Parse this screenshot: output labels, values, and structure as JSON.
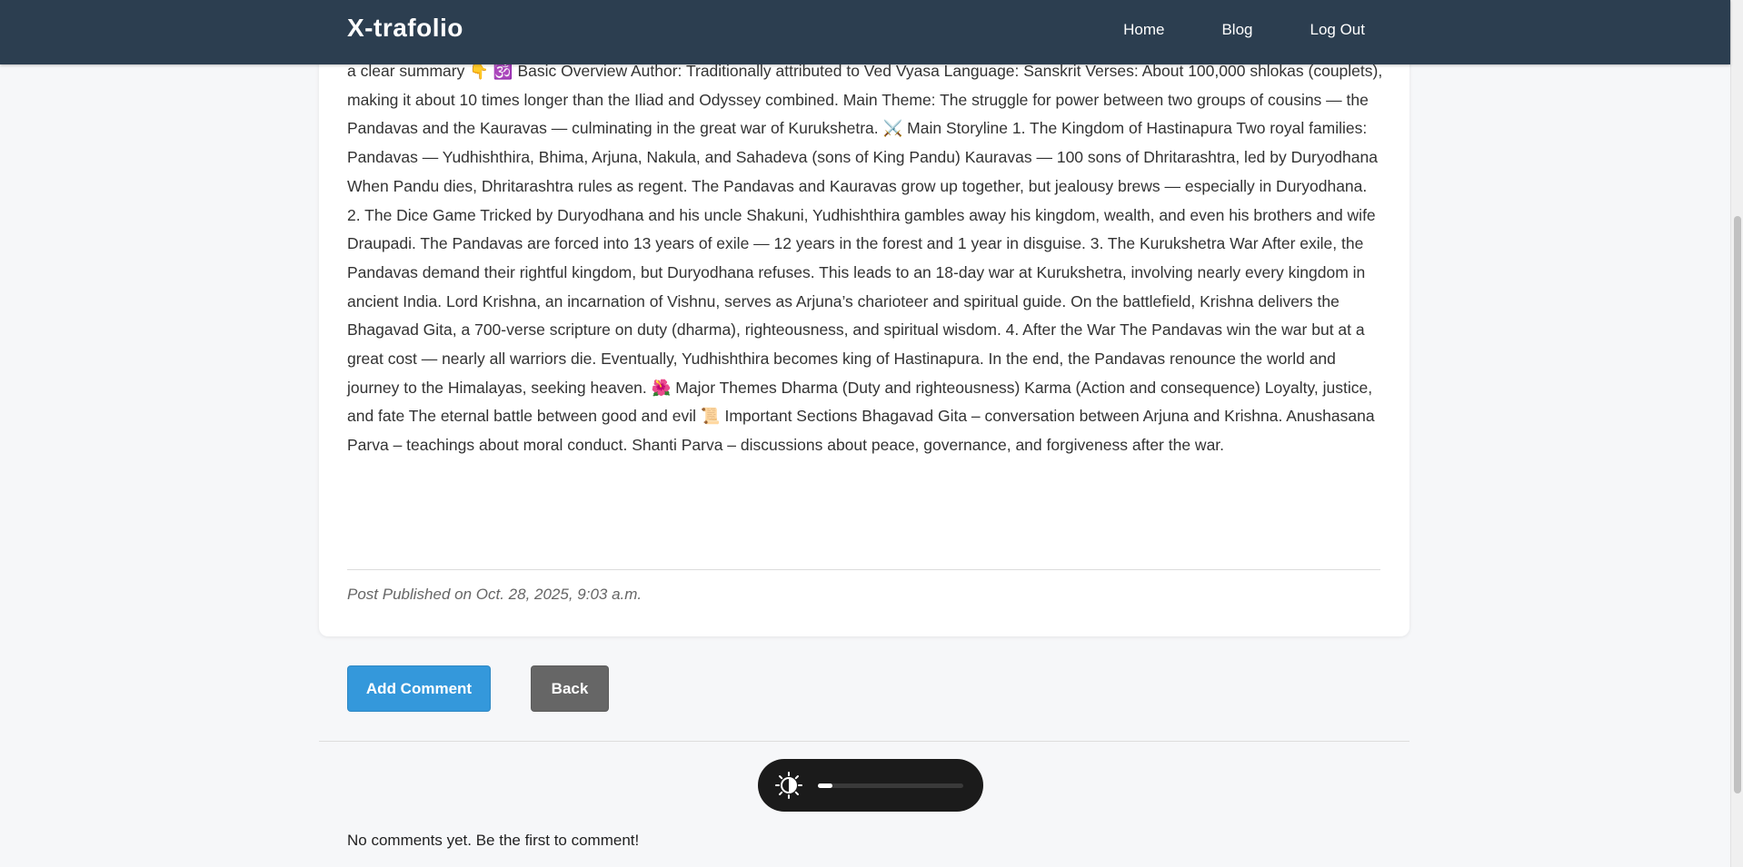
{
  "navbar": {
    "brand": "X-trafolio",
    "links": [
      "Home",
      "Blog",
      "Log Out"
    ]
  },
  "post": {
    "body": "a clear summary 👇 🕉️ Basic Overview Author: Traditionally attributed to Ved Vyasa Language: Sanskrit Verses: About 100,000 shlokas (couplets), making it about 10 times longer than the Iliad and Odyssey combined. Main Theme: The struggle for power between two groups of cousins — the Pandavas and the Kauravas — culminating in the great war of Kurukshetra. ⚔️ Main Storyline 1. The Kingdom of Hastinapura Two royal families: Pandavas — Yudhishthira, Bhima, Arjuna, Nakula, and Sahadeva (sons of King Pandu) Kauravas — 100 sons of Dhritarashtra, led by Duryodhana When Pandu dies, Dhritarashtra rules as regent. The Pandavas and Kauravas grow up together, but jealousy brews — especially in Duryodhana. 2. The Dice Game Tricked by Duryodhana and his uncle Shakuni, Yudhishthira gambles away his kingdom, wealth, and even his brothers and wife Draupadi. The Pandavas are forced into 13 years of exile — 12 years in the forest and 1 year in disguise. 3. The Kurukshetra War After exile, the Pandavas demand their rightful kingdom, but Duryodhana refuses. This leads to an 18-day war at Kurukshetra, involving nearly every kingdom in ancient India. Lord Krishna, an incarnation of Vishnu, serves as Arjuna’s charioteer and spiritual guide. On the battlefield, Krishna delivers the Bhagavad Gita, a 700-verse scripture on duty (dharma), righteousness, and spiritual wisdom. 4. After the War The Pandavas win the war but at a great cost — nearly all warriors die. Eventually, Yudhishthira becomes king of Hastinapura. In the end, the Pandavas renounce the world and journey to the Himalayas, seeking heaven. 🌺 Major Themes Dharma (Duty and righteousness) Karma (Action and consequence) Loyalty, justice, and fate The eternal battle between good and evil 📜 Important Sections Bhagavad Gita – conversation between Arjuna and Krishna. Anushasana Parva – teachings about moral conduct. Shanti Parva – discussions about peace, governance, and forgiveness after the war.",
    "published": "Post Published on Oct. 28, 2025, 9:03 a.m."
  },
  "actions": {
    "add_comment": "Add Comment",
    "back": "Back"
  },
  "contrast_widget": {
    "icon": "contrast-icon",
    "level": 0.1
  },
  "comments": {
    "empty_message": "No comments yet. Be the first to comment!"
  },
  "colors": {
    "navbar": "#2c3e50",
    "accent": "#3498db",
    "back_button": "#666666",
    "widget": "#1b1b1b"
  }
}
